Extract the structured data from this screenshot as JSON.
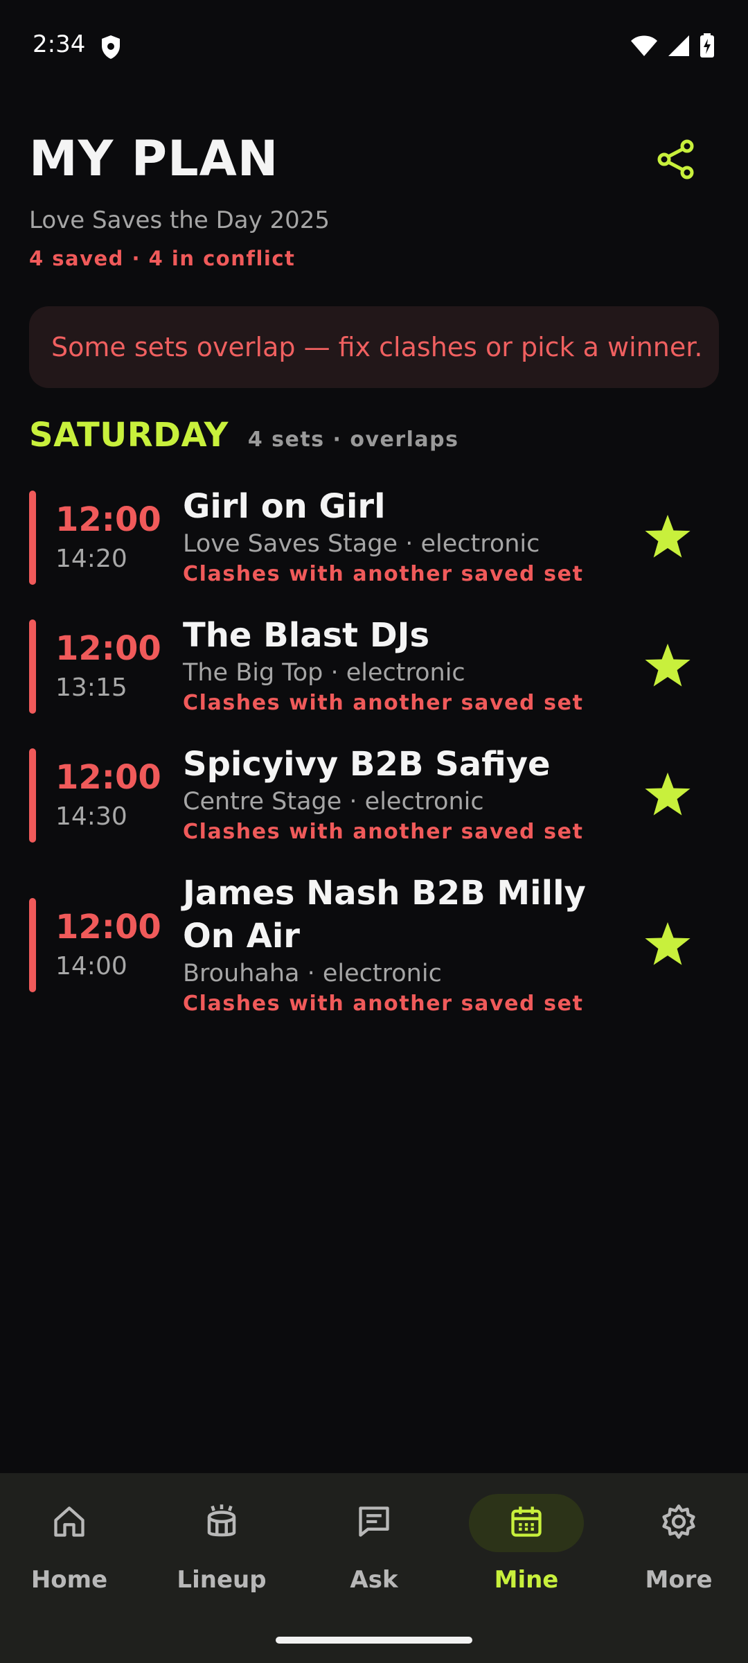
{
  "status_bar": {
    "time": "2:34"
  },
  "header": {
    "title": "MY PLAN",
    "festival": "Love Saves the Day 2025",
    "summary": "4 saved · 4 in conflict",
    "share_icon": "share-icon"
  },
  "banner": {
    "text": "Some sets overlap — fix clashes or pick a winner."
  },
  "day": {
    "title": "SATURDAY",
    "meta": "4 sets · overlaps",
    "sets": [
      {
        "start": "12:00",
        "end": "14:20",
        "artist": "Girl on Girl",
        "venue": "Love Saves Stage · electronic",
        "clash": "Clashes with another saved set"
      },
      {
        "start": "12:00",
        "end": "13:15",
        "artist": "The Blast DJs",
        "venue": "The Big Top · electronic",
        "clash": "Clashes with another saved set"
      },
      {
        "start": "12:00",
        "end": "14:30",
        "artist": "Spicyivy B2B Safiye",
        "venue": "Centre Stage · electronic",
        "clash": "Clashes with another saved set"
      },
      {
        "start": "12:00",
        "end": "14:00",
        "artist": "James Nash B2B Milly On Air",
        "venue": "Brouhaha · electronic",
        "clash": "Clashes with another saved set"
      }
    ]
  },
  "nav": {
    "items": [
      {
        "label": "Home",
        "icon": "home-icon"
      },
      {
        "label": "Lineup",
        "icon": "stage-icon"
      },
      {
        "label": "Ask",
        "icon": "chat-icon"
      },
      {
        "label": "Mine",
        "icon": "calendar-icon",
        "active": true
      },
      {
        "label": "More",
        "icon": "gear-icon"
      }
    ]
  },
  "colors": {
    "accent": "#c8f03c",
    "conflict": "#f05a5a",
    "background": "#0b0b0d"
  }
}
